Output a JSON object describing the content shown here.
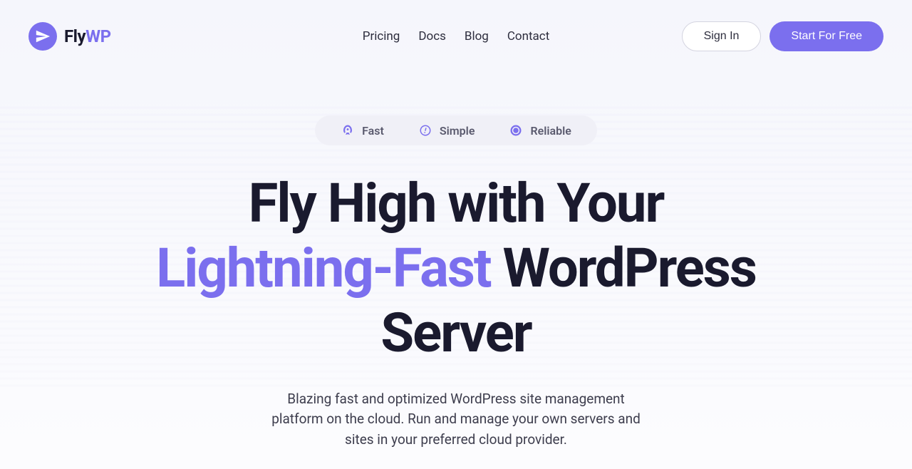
{
  "logo": {
    "text_prefix": "Fly",
    "text_accent": "WP"
  },
  "nav": {
    "pricing": "Pricing",
    "docs": "Docs",
    "blog": "Blog",
    "contact": "Contact"
  },
  "header": {
    "signin": "Sign In",
    "start": "Start For Free"
  },
  "badges": {
    "fast": "Fast",
    "simple": "Simple",
    "reliable": "Reliable"
  },
  "hero": {
    "title_line1": "Fly High with Your",
    "title_highlight": "Lightning-Fast",
    "title_after": " WordPress Server",
    "subtitle": "Blazing fast and optimized WordPress site management platform on the cloud. Run and manage your own servers and sites in your preferred cloud provider."
  }
}
